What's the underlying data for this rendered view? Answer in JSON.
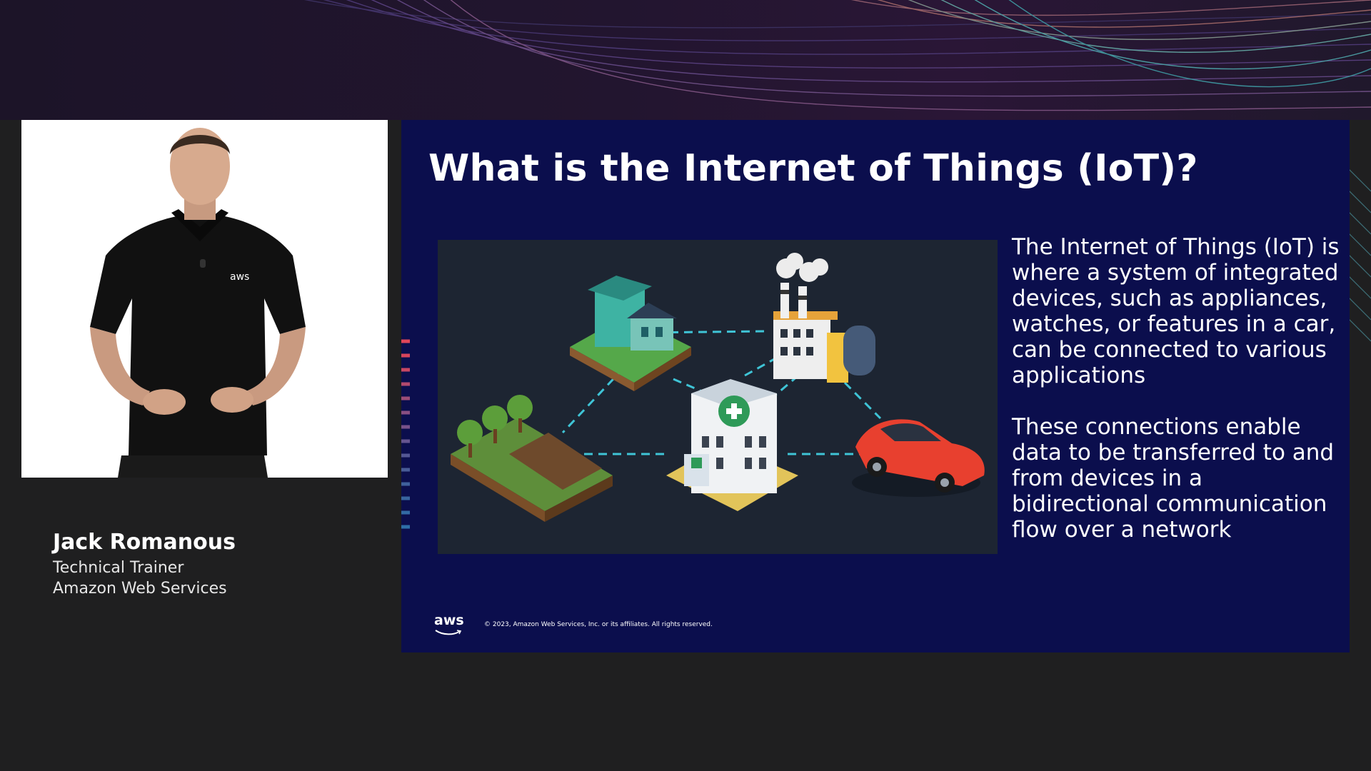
{
  "presenter": {
    "name": "Jack Romanous",
    "role": "Technical Trainer",
    "company": "Amazon Web Services",
    "shirt_logo": "aws"
  },
  "slide": {
    "title": "What is the Internet of Things (IoT)?",
    "paragraphs": [
      "The Internet of Things (IoT) is where a system of integrated devices, such as appliances, watches, or features in a car, can be connected to various applications",
      "These connections enable data to be transferred to and from devices in a bidirectional communication flow over a network"
    ],
    "logo": "aws",
    "copyright": "© 2023, Amazon Web Services, Inc. or its affiliates. All rights reserved."
  },
  "illustration": {
    "items": [
      "house-icon",
      "factory-icon",
      "farm-icon",
      "hospital-icon",
      "car-icon"
    ]
  },
  "colors": {
    "slide_background": "#0b0e4d",
    "connection_line": "#3fc4d6",
    "car": "#e8402f",
    "banner": "#22152f",
    "aws_orange": "#ff9900"
  }
}
